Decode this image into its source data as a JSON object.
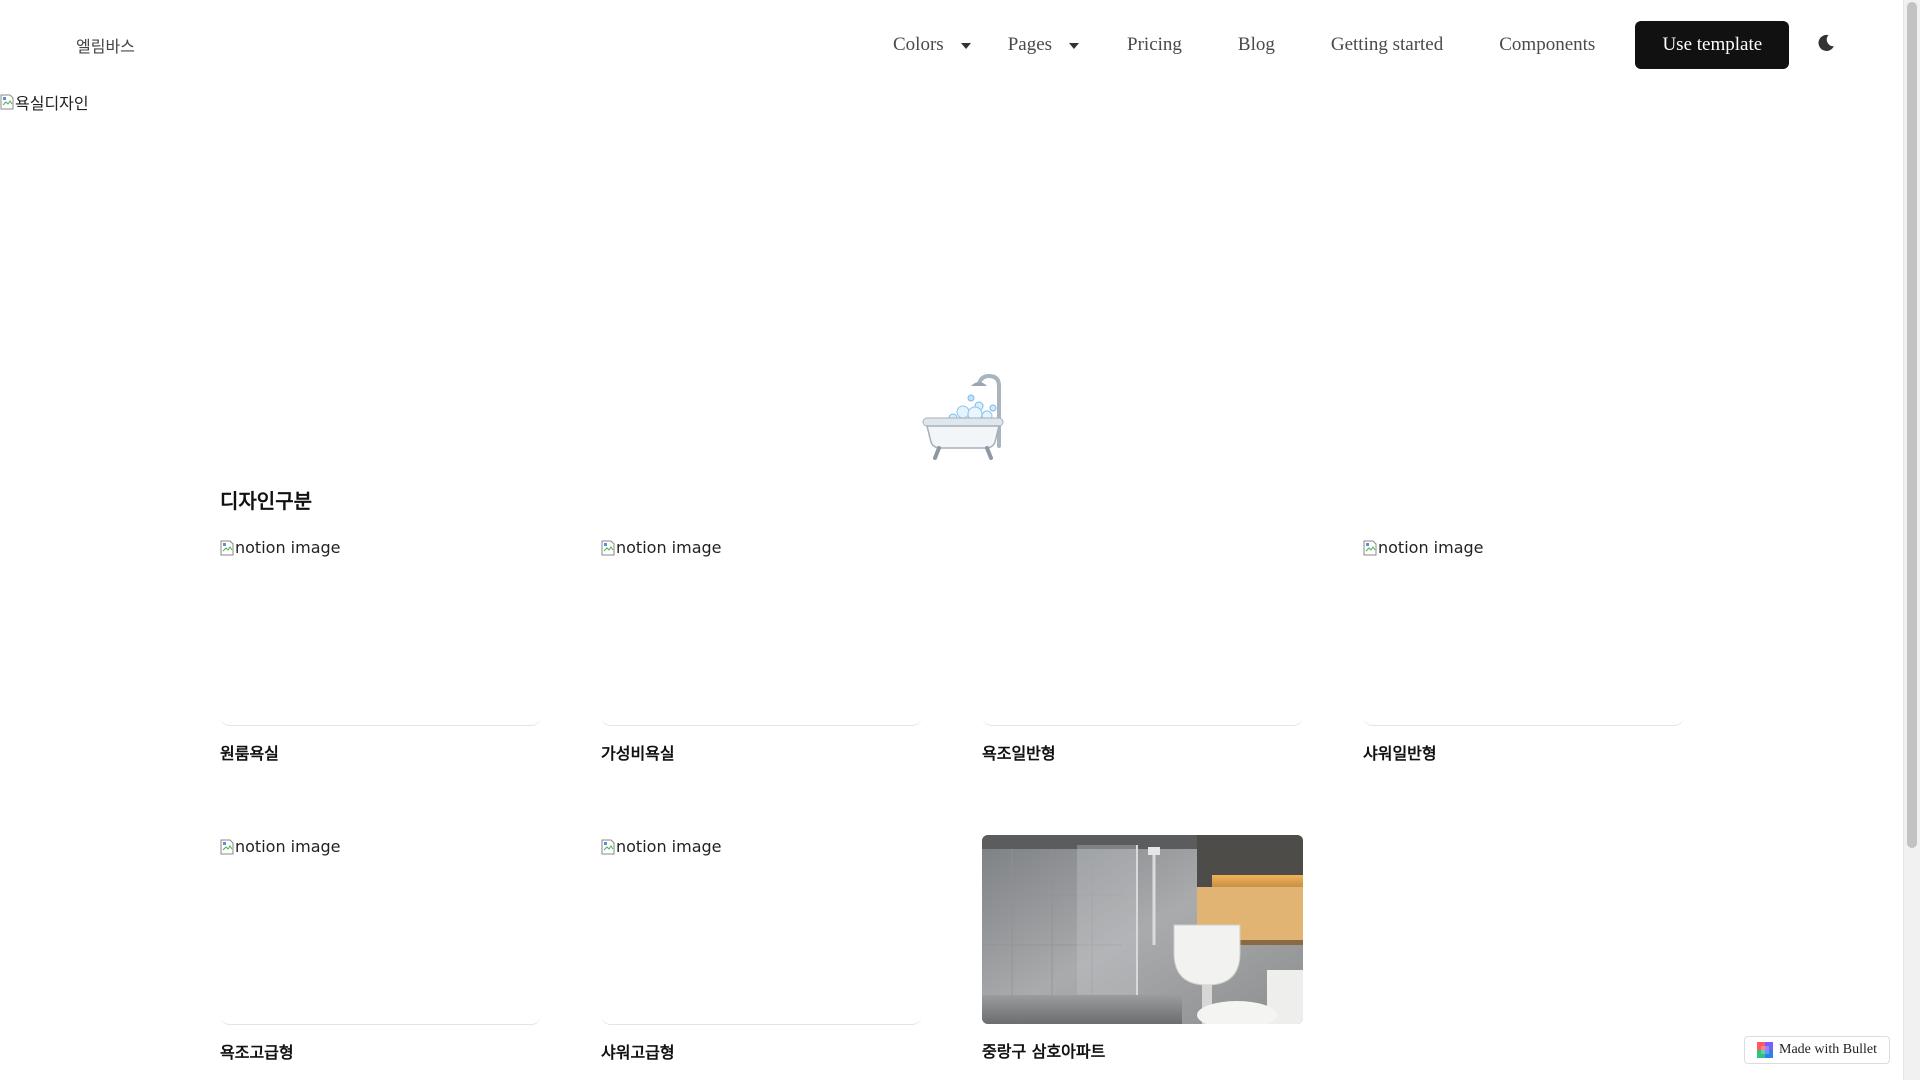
{
  "header": {
    "logo_text": "엘림바스",
    "nav": {
      "colors": "Colors",
      "pages": "Pages",
      "pricing": "Pricing",
      "blog": "Blog",
      "getting_started": "Getting started",
      "components": "Components"
    },
    "cta_label": "Use template",
    "theme_toggle_icon": "moon-icon"
  },
  "cover": {
    "alt_text": "욕실디자인"
  },
  "page_icon": "bathtub-icon",
  "section": {
    "title": "디자인구분",
    "cards": [
      {
        "title": "원룸욕실",
        "image_alt": "notion image",
        "image_state": "broken"
      },
      {
        "title": "가성비욕실",
        "image_alt": "notion image",
        "image_state": "broken"
      },
      {
        "title": "욕조일반형",
        "image_alt": "",
        "image_state": "blank"
      },
      {
        "title": "샤워일반형",
        "image_alt": "notion image",
        "image_state": "broken"
      },
      {
        "title": "욕조고급형",
        "image_alt": "notion image",
        "image_state": "broken"
      },
      {
        "title": "샤워고급형",
        "image_alt": "notion image",
        "image_state": "broken"
      },
      {
        "title": "중랑구 삼호아파트",
        "image_alt": "",
        "image_state": "photo"
      }
    ]
  },
  "badge": {
    "label": "Made with Bullet"
  },
  "colors": {
    "cta_background": "#111111",
    "cta_text": "#ffffff",
    "nav_text": "#4a4a4a"
  }
}
